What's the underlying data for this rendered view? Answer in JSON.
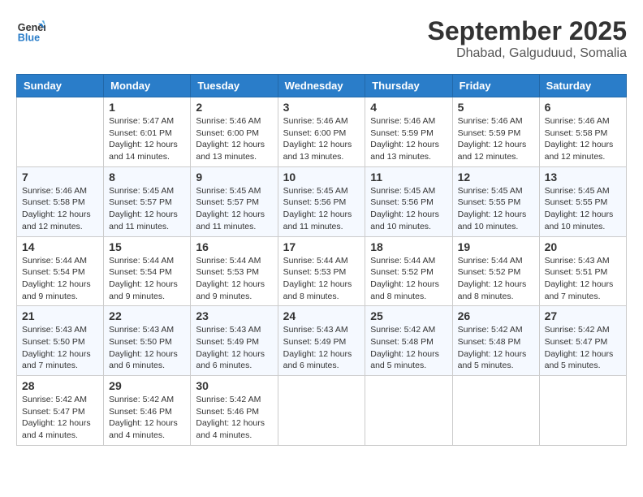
{
  "header": {
    "logo_line1": "General",
    "logo_line2": "Blue",
    "month": "September 2025",
    "location": "Dhabad, Galguduud, Somalia"
  },
  "weekdays": [
    "Sunday",
    "Monday",
    "Tuesday",
    "Wednesday",
    "Thursday",
    "Friday",
    "Saturday"
  ],
  "weeks": [
    [
      {
        "day": "",
        "info": ""
      },
      {
        "day": "1",
        "info": "Sunrise: 5:47 AM\nSunset: 6:01 PM\nDaylight: 12 hours\nand 14 minutes."
      },
      {
        "day": "2",
        "info": "Sunrise: 5:46 AM\nSunset: 6:00 PM\nDaylight: 12 hours\nand 13 minutes."
      },
      {
        "day": "3",
        "info": "Sunrise: 5:46 AM\nSunset: 6:00 PM\nDaylight: 12 hours\nand 13 minutes."
      },
      {
        "day": "4",
        "info": "Sunrise: 5:46 AM\nSunset: 5:59 PM\nDaylight: 12 hours\nand 13 minutes."
      },
      {
        "day": "5",
        "info": "Sunrise: 5:46 AM\nSunset: 5:59 PM\nDaylight: 12 hours\nand 12 minutes."
      },
      {
        "day": "6",
        "info": "Sunrise: 5:46 AM\nSunset: 5:58 PM\nDaylight: 12 hours\nand 12 minutes."
      }
    ],
    [
      {
        "day": "7",
        "info": "Sunrise: 5:46 AM\nSunset: 5:58 PM\nDaylight: 12 hours\nand 12 minutes."
      },
      {
        "day": "8",
        "info": "Sunrise: 5:45 AM\nSunset: 5:57 PM\nDaylight: 12 hours\nand 11 minutes."
      },
      {
        "day": "9",
        "info": "Sunrise: 5:45 AM\nSunset: 5:57 PM\nDaylight: 12 hours\nand 11 minutes."
      },
      {
        "day": "10",
        "info": "Sunrise: 5:45 AM\nSunset: 5:56 PM\nDaylight: 12 hours\nand 11 minutes."
      },
      {
        "day": "11",
        "info": "Sunrise: 5:45 AM\nSunset: 5:56 PM\nDaylight: 12 hours\nand 10 minutes."
      },
      {
        "day": "12",
        "info": "Sunrise: 5:45 AM\nSunset: 5:55 PM\nDaylight: 12 hours\nand 10 minutes."
      },
      {
        "day": "13",
        "info": "Sunrise: 5:45 AM\nSunset: 5:55 PM\nDaylight: 12 hours\nand 10 minutes."
      }
    ],
    [
      {
        "day": "14",
        "info": "Sunrise: 5:44 AM\nSunset: 5:54 PM\nDaylight: 12 hours\nand 9 minutes."
      },
      {
        "day": "15",
        "info": "Sunrise: 5:44 AM\nSunset: 5:54 PM\nDaylight: 12 hours\nand 9 minutes."
      },
      {
        "day": "16",
        "info": "Sunrise: 5:44 AM\nSunset: 5:53 PM\nDaylight: 12 hours\nand 9 minutes."
      },
      {
        "day": "17",
        "info": "Sunrise: 5:44 AM\nSunset: 5:53 PM\nDaylight: 12 hours\nand 8 minutes."
      },
      {
        "day": "18",
        "info": "Sunrise: 5:44 AM\nSunset: 5:52 PM\nDaylight: 12 hours\nand 8 minutes."
      },
      {
        "day": "19",
        "info": "Sunrise: 5:44 AM\nSunset: 5:52 PM\nDaylight: 12 hours\nand 8 minutes."
      },
      {
        "day": "20",
        "info": "Sunrise: 5:43 AM\nSunset: 5:51 PM\nDaylight: 12 hours\nand 7 minutes."
      }
    ],
    [
      {
        "day": "21",
        "info": "Sunrise: 5:43 AM\nSunset: 5:50 PM\nDaylight: 12 hours\nand 7 minutes."
      },
      {
        "day": "22",
        "info": "Sunrise: 5:43 AM\nSunset: 5:50 PM\nDaylight: 12 hours\nand 6 minutes."
      },
      {
        "day": "23",
        "info": "Sunrise: 5:43 AM\nSunset: 5:49 PM\nDaylight: 12 hours\nand 6 minutes."
      },
      {
        "day": "24",
        "info": "Sunrise: 5:43 AM\nSunset: 5:49 PM\nDaylight: 12 hours\nand 6 minutes."
      },
      {
        "day": "25",
        "info": "Sunrise: 5:42 AM\nSunset: 5:48 PM\nDaylight: 12 hours\nand 5 minutes."
      },
      {
        "day": "26",
        "info": "Sunrise: 5:42 AM\nSunset: 5:48 PM\nDaylight: 12 hours\nand 5 minutes."
      },
      {
        "day": "27",
        "info": "Sunrise: 5:42 AM\nSunset: 5:47 PM\nDaylight: 12 hours\nand 5 minutes."
      }
    ],
    [
      {
        "day": "28",
        "info": "Sunrise: 5:42 AM\nSunset: 5:47 PM\nDaylight: 12 hours\nand 4 minutes."
      },
      {
        "day": "29",
        "info": "Sunrise: 5:42 AM\nSunset: 5:46 PM\nDaylight: 12 hours\nand 4 minutes."
      },
      {
        "day": "30",
        "info": "Sunrise: 5:42 AM\nSunset: 5:46 PM\nDaylight: 12 hours\nand 4 minutes."
      },
      {
        "day": "",
        "info": ""
      },
      {
        "day": "",
        "info": ""
      },
      {
        "day": "",
        "info": ""
      },
      {
        "day": "",
        "info": ""
      }
    ]
  ]
}
